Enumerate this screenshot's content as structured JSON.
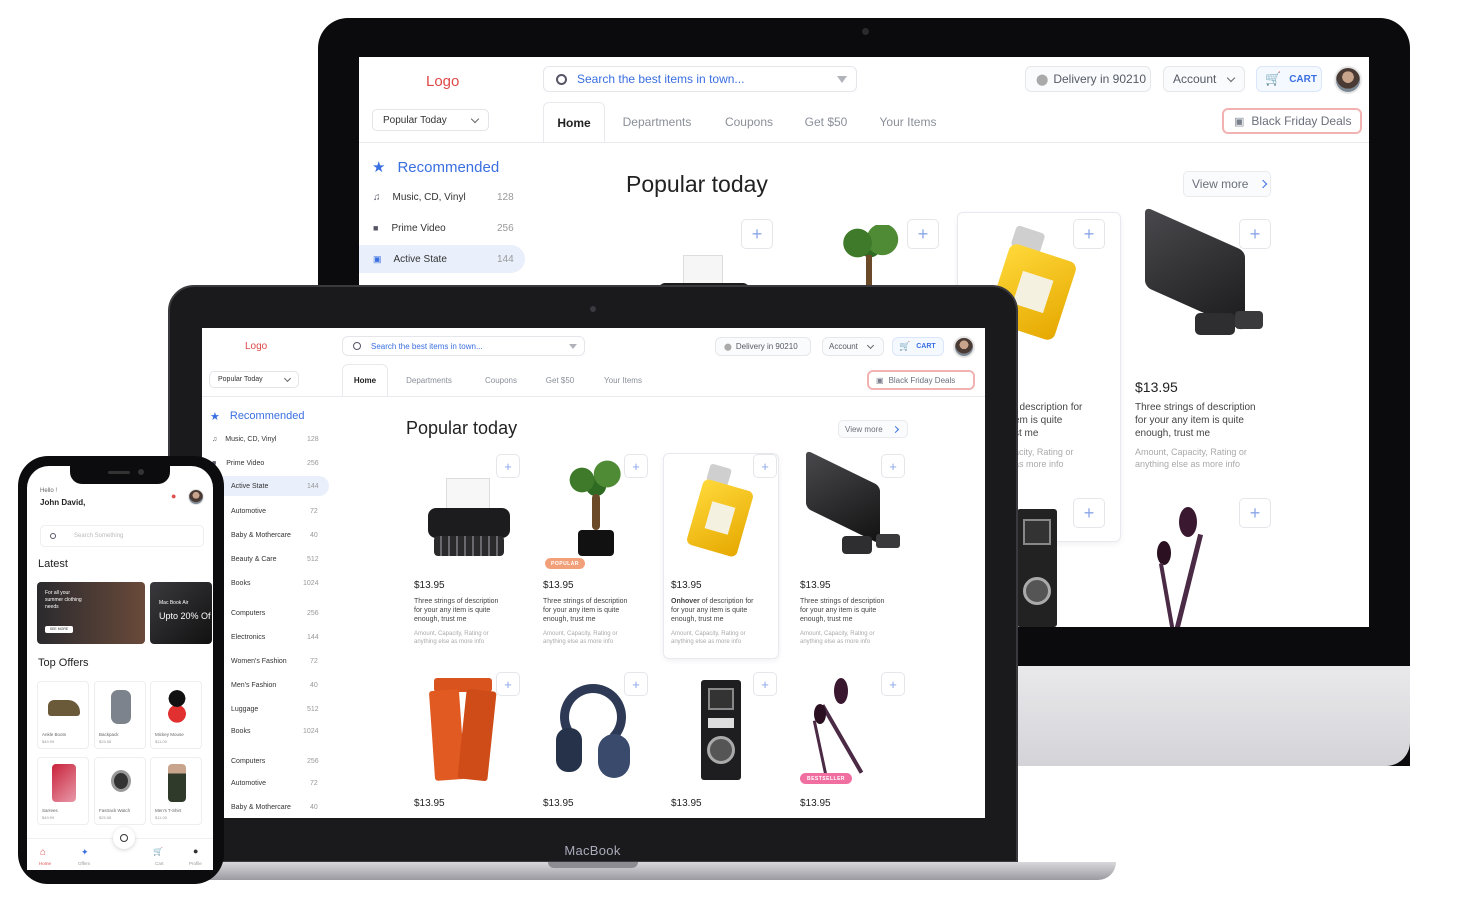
{
  "header": {
    "logo": "Logo",
    "search_placeholder": "Search the best items in town...",
    "delivery": "Delivery in 90210",
    "account": "Account",
    "cart": "CART",
    "popular_dropdown": "Popular Today",
    "black_friday": "Black Friday Deals"
  },
  "tabs": [
    "Home",
    "Departments",
    "Coupons",
    "Get $50",
    "Your Items"
  ],
  "sidebar": {
    "heading": "Recommended",
    "items": [
      {
        "label": "Music, CD, Vinyl",
        "count": "128"
      },
      {
        "label": "Prime Video",
        "count": "256"
      },
      {
        "label": "Active State",
        "count": "144"
      },
      {
        "label": "Automotive",
        "count": "72"
      },
      {
        "label": "Baby & Mothercare",
        "count": "40"
      },
      {
        "label": "Beauty & Care",
        "count": "512"
      },
      {
        "label": "Books",
        "count": "1024"
      },
      {
        "label": "Computers",
        "count": "256"
      },
      {
        "label": "Electronics",
        "count": "144"
      },
      {
        "label": "Women's Fashion",
        "count": "72"
      },
      {
        "label": "Men's Fashion",
        "count": "40"
      },
      {
        "label": "Luggage",
        "count": "512"
      },
      {
        "label": "Books",
        "count": "1024"
      },
      {
        "label": "Computers",
        "count": "256"
      },
      {
        "label": "Automotive",
        "count": "72"
      },
      {
        "label": "Baby & Mothercare",
        "count": "40"
      }
    ]
  },
  "main": {
    "title": "Popular today",
    "view_more": "View more",
    "products": [
      {
        "price": "$13.95",
        "desc1": "Three strings of description",
        "desc2": "for your any item is quite",
        "desc3": "enough, trust me",
        "meta1": "Amount, Capacity, Rating or",
        "meta2": "anything else as more info"
      },
      {
        "price": "$13.95",
        "badge": "POPULAR",
        "desc1": "Three strings of description",
        "desc2": "for your any item is quite",
        "desc3": "enough, trust me",
        "meta1": "Amount, Capacity, Rating or",
        "meta2": "anything else as more info"
      },
      {
        "price": "$13.95",
        "desc_bold": "Onhover",
        "desc1": " of description for",
        "desc2": "for your any item is quite",
        "desc3": "enough, trust me",
        "meta1": "Amount, Capacity, Rating or",
        "meta2": "anything else as more info"
      },
      {
        "price": "$13.95",
        "desc1": "Three strings of description",
        "desc2": "for your any item is quite",
        "desc3": "enough, trust me",
        "meta1": "Amount, Capacity, Rating or",
        "meta2": "anything else as more info"
      }
    ],
    "row2": [
      {
        "price": "$13.95"
      },
      {
        "price": "$13.95"
      },
      {
        "price": "$13.95"
      },
      {
        "price": "$13.95",
        "badge": "BESTSELLER"
      }
    ],
    "imac_partial_desc": {
      "line1": "f description for",
      "line2": "em is quite",
      "line3": "st me",
      "meta1": "acity, Rating or",
      "meta2": "as more info"
    }
  },
  "laptop_brand": "MacBook",
  "phone": {
    "greeting": "Hello !",
    "user": "John David,",
    "search_placeholder": "Search Something",
    "latest": "Latest",
    "banner1_l1": "For all your",
    "banner1_l2": "summer clothing",
    "banner1_l3": "needs",
    "banner1_btn": "SEE MORE",
    "banner2_title": "Mac Book Air",
    "banner2_offer": "Upto 20% Of",
    "top_offers": "Top Offers",
    "offers": [
      {
        "name": "Ankle Boots",
        "price": "$49.99"
      },
      {
        "name": "Backpack",
        "price": "$25.58"
      },
      {
        "name": "Mickey Mouse",
        "price": "$11.00"
      },
      {
        "name": "Sarrees",
        "price": "$49.99"
      },
      {
        "name": "Fastrack Watch",
        "price": "$25.58"
      },
      {
        "name": "Men's T-Shirt",
        "price": "$11.00"
      }
    ],
    "nav": [
      "Home",
      "Offers",
      "Cart",
      "Profile"
    ]
  },
  "colors": {
    "accent": "#3a6fe0",
    "logo": "#e04848",
    "badge_popular": "#f2a07a",
    "badge_bestseller": "#f06fa0"
  }
}
